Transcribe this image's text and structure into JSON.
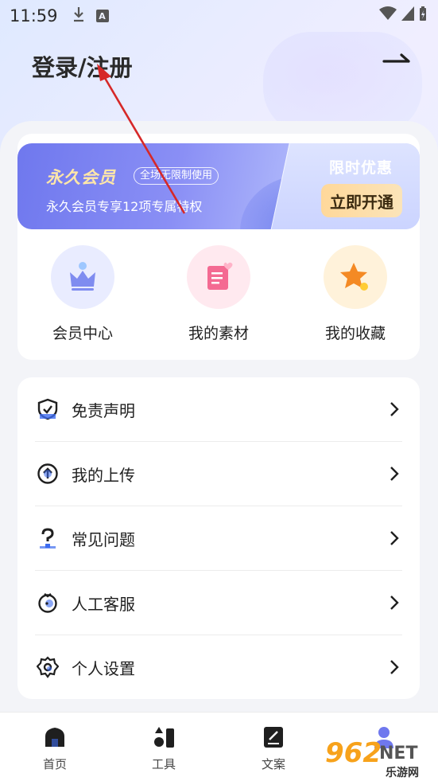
{
  "status_bar": {
    "time": "11:59",
    "download_icon": "download-icon",
    "a_badge": "A"
  },
  "header": {
    "title": "登录/注册",
    "exit_icon": "exit-arrow-icon"
  },
  "vip": {
    "title": "永久会员",
    "tag": "全场无限制使用",
    "subtitle": "永久会员专享12项专属特权",
    "limit": "限时优惠",
    "open_button": "立即开通"
  },
  "quick_actions": [
    {
      "label": "会员中心",
      "icon": "crown-icon",
      "color": "#e9ecff"
    },
    {
      "label": "我的素材",
      "icon": "document-heart-icon",
      "color": "#ffe9ef"
    },
    {
      "label": "我的收藏",
      "icon": "star-icon",
      "color": "#fff2da"
    }
  ],
  "menu": [
    {
      "label": "免责声明",
      "icon": "shield-check-icon"
    },
    {
      "label": "我的上传",
      "icon": "upload-icon"
    },
    {
      "label": "常见问题",
      "icon": "question-icon"
    },
    {
      "label": "人工客服",
      "icon": "headset-icon"
    },
    {
      "label": "个人设置",
      "icon": "gear-icon"
    }
  ],
  "bottom_nav": [
    {
      "label": "首页",
      "icon": "home-icon"
    },
    {
      "label": "工具",
      "icon": "tools-icon"
    },
    {
      "label": "文案",
      "icon": "copywriting-icon"
    },
    {
      "label": "",
      "icon": "profile-icon"
    }
  ],
  "watermark": {
    "number": "962",
    "suffix": "NET",
    "site": "乐游网"
  },
  "colors": {
    "accent": "#6f78ee",
    "gold": "#ffd89a",
    "annotation_arrow": "#d62828"
  }
}
